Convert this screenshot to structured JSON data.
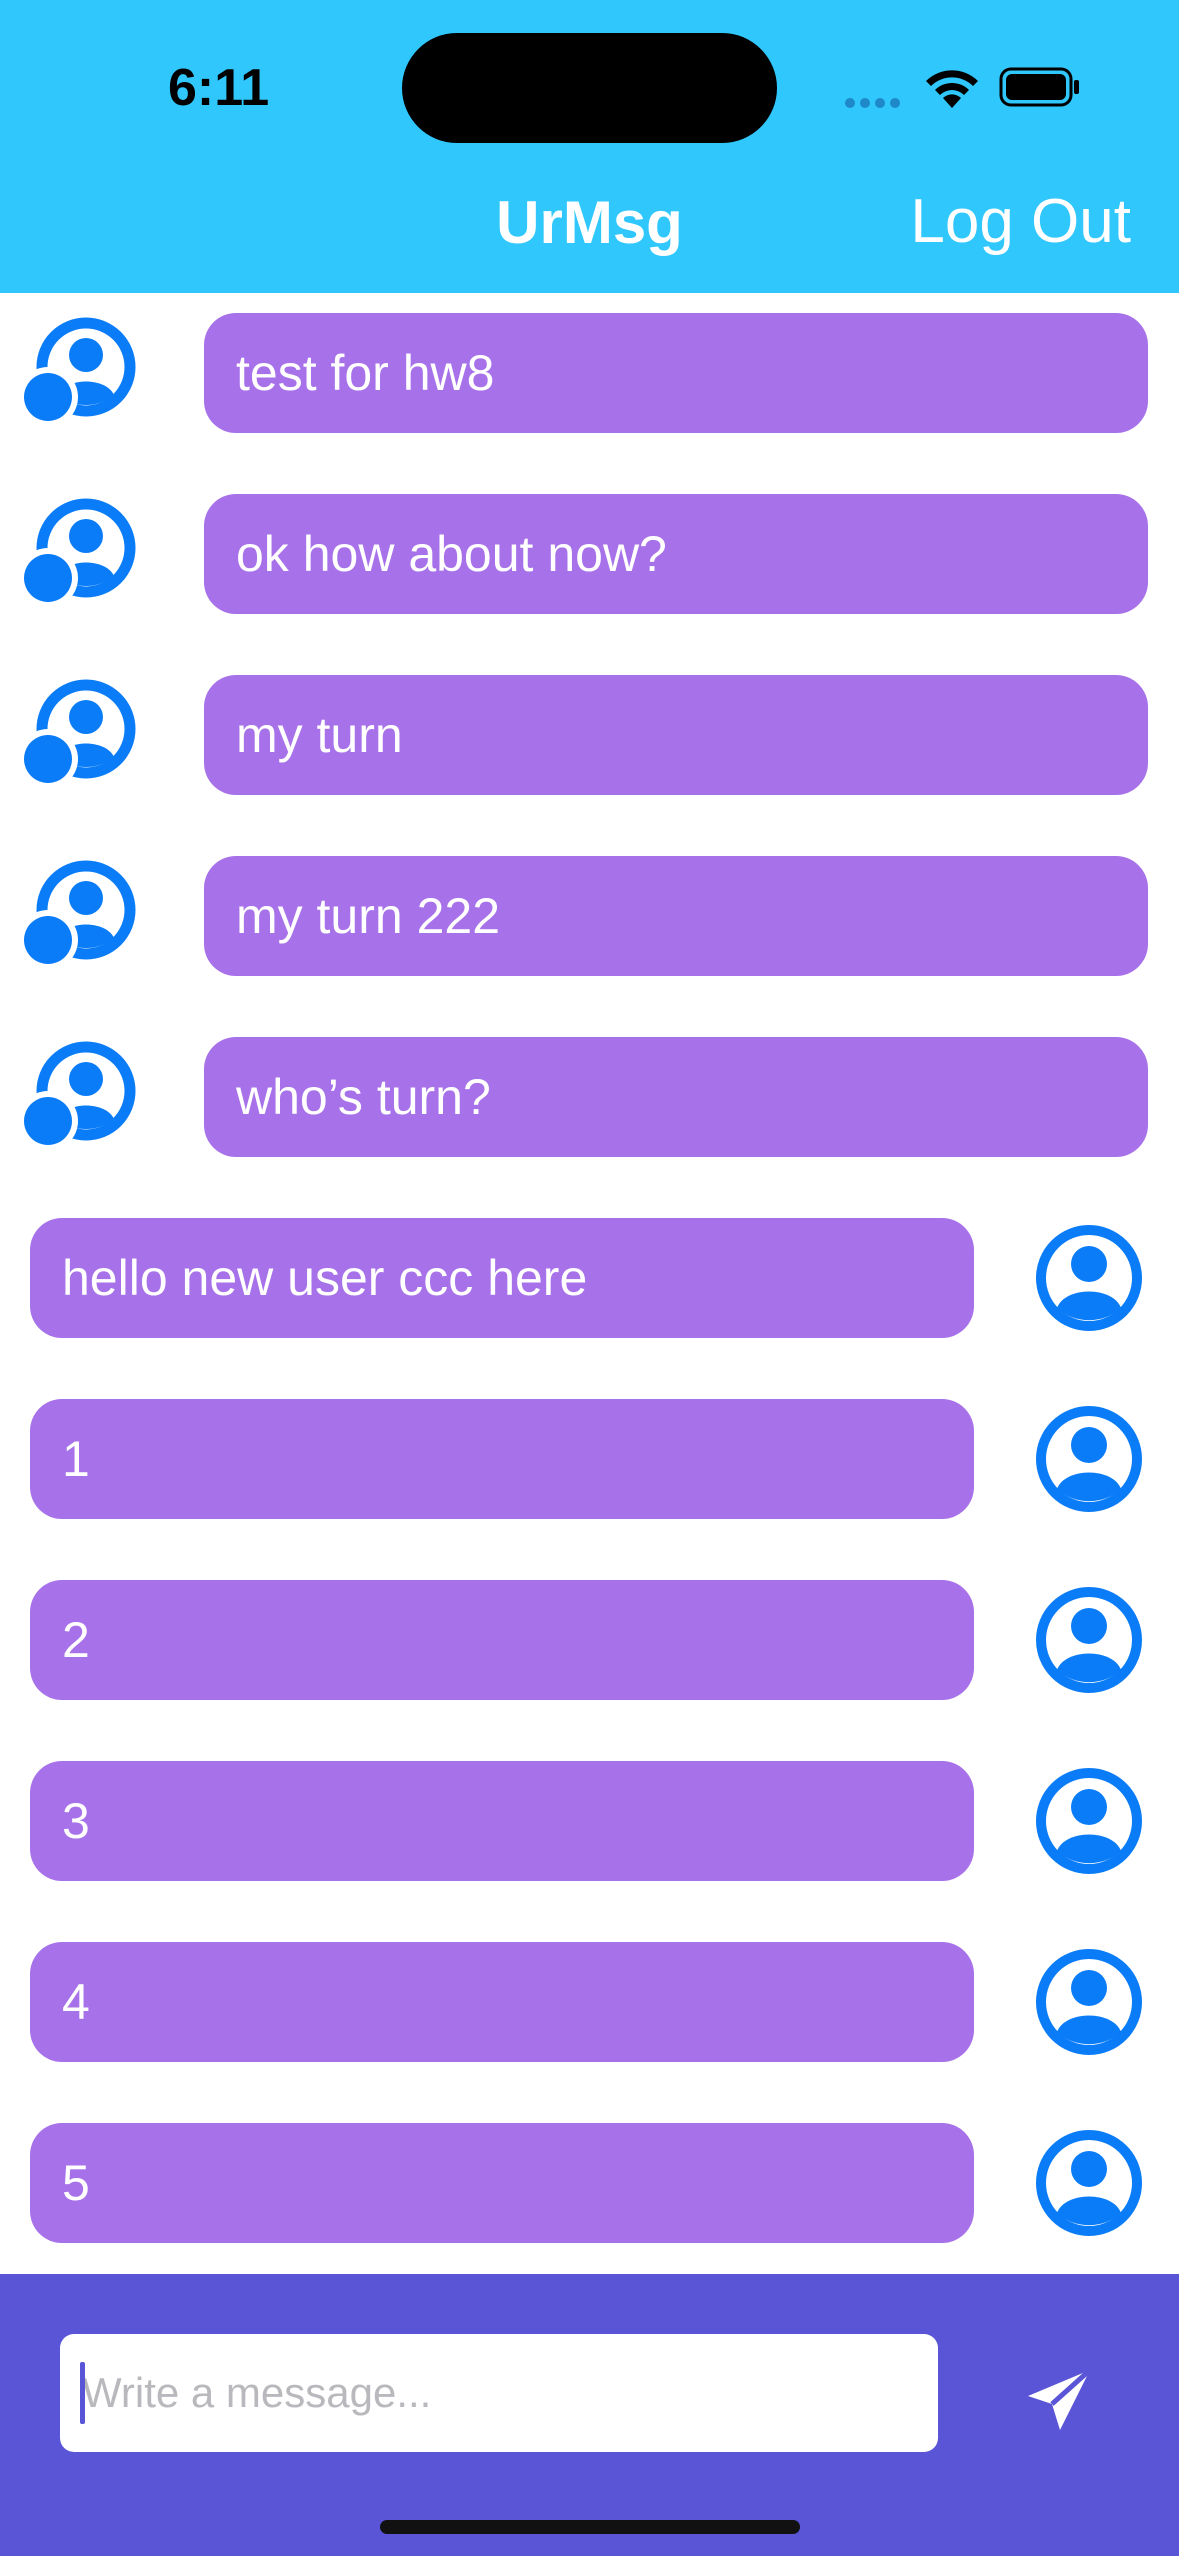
{
  "status_bar": {
    "time": "6:11"
  },
  "header": {
    "title": "UrMsg",
    "logout_label": "Log Out",
    "background": "#2FC7FC"
  },
  "messages": [
    {
      "direction": "incoming",
      "text": "test for hw8",
      "avatar_icon": "person-group-icon"
    },
    {
      "direction": "incoming",
      "text": "ok how about now?",
      "avatar_icon": "person-group-icon"
    },
    {
      "direction": "incoming",
      "text": "my turn",
      "avatar_icon": "person-group-icon"
    },
    {
      "direction": "incoming",
      "text": "my turn 222",
      "avatar_icon": "person-group-icon"
    },
    {
      "direction": "incoming",
      "text": "who’s turn?",
      "avatar_icon": "person-group-icon"
    },
    {
      "direction": "outgoing",
      "text": "hello new user ccc here",
      "avatar_icon": "person-circle-icon"
    },
    {
      "direction": "outgoing",
      "text": "1",
      "avatar_icon": "person-circle-icon"
    },
    {
      "direction": "outgoing",
      "text": "2",
      "avatar_icon": "person-circle-icon"
    },
    {
      "direction": "outgoing",
      "text": "3",
      "avatar_icon": "person-circle-icon"
    },
    {
      "direction": "outgoing",
      "text": "4",
      "avatar_icon": "person-circle-icon"
    },
    {
      "direction": "outgoing",
      "text": "5",
      "avatar_icon": "person-circle-icon"
    }
  ],
  "composer": {
    "placeholder": "Write a message...",
    "value": "",
    "send_icon": "paper-plane-icon",
    "background": "#5A55D7"
  },
  "colors": {
    "bubble": "#A772E9",
    "avatar": "#0A7CF7"
  }
}
